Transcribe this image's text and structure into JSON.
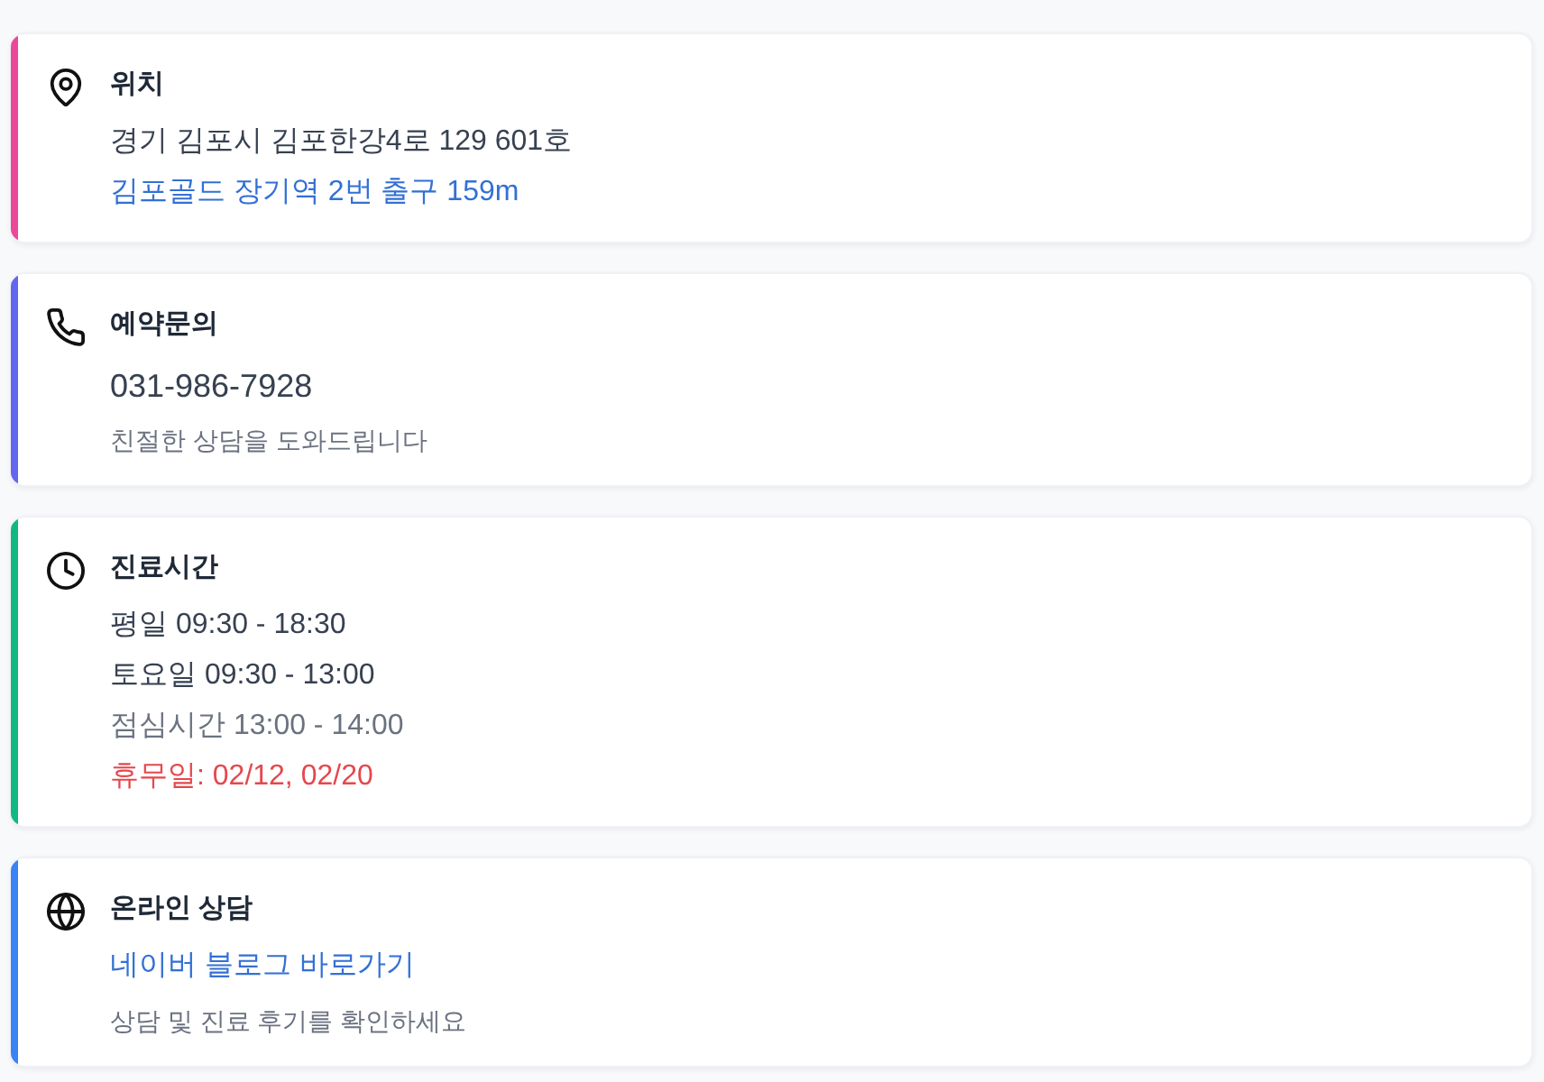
{
  "cards": [
    {
      "kind": "location",
      "color": "#ec4899",
      "title": "위치",
      "lines": [
        {
          "kind": "body",
          "text": "경기 김포시 김포한강4로 129 601호"
        },
        {
          "kind": "link",
          "text": "김포골드 장기역 2번 출구 159m"
        }
      ]
    },
    {
      "kind": "phone",
      "color": "#6366f1",
      "title": "예약문의",
      "lines": [
        {
          "kind": "phone",
          "text": "031-986-7928"
        },
        {
          "kind": "note",
          "text": "친절한 상담을 도와드립니다"
        }
      ]
    },
    {
      "kind": "hours",
      "color": "#10b981",
      "title": "진료시간",
      "lines": [
        {
          "kind": "body",
          "text": "평일 09:30 - 18:30"
        },
        {
          "kind": "body",
          "text": "토요일 09:30 - 13:00"
        },
        {
          "kind": "muted",
          "text": "점심시간 13:00 - 14:00"
        },
        {
          "kind": "alert",
          "text": "휴무일: 02/12, 02/20"
        }
      ]
    },
    {
      "kind": "online",
      "color": "#3b82f6",
      "title": "온라인 상담",
      "lines": [
        {
          "kind": "link",
          "text": "네이버 블로그 바로가기"
        },
        {
          "kind": "note",
          "text": "상담 및 진료 후기를 확인하세요"
        }
      ]
    }
  ]
}
